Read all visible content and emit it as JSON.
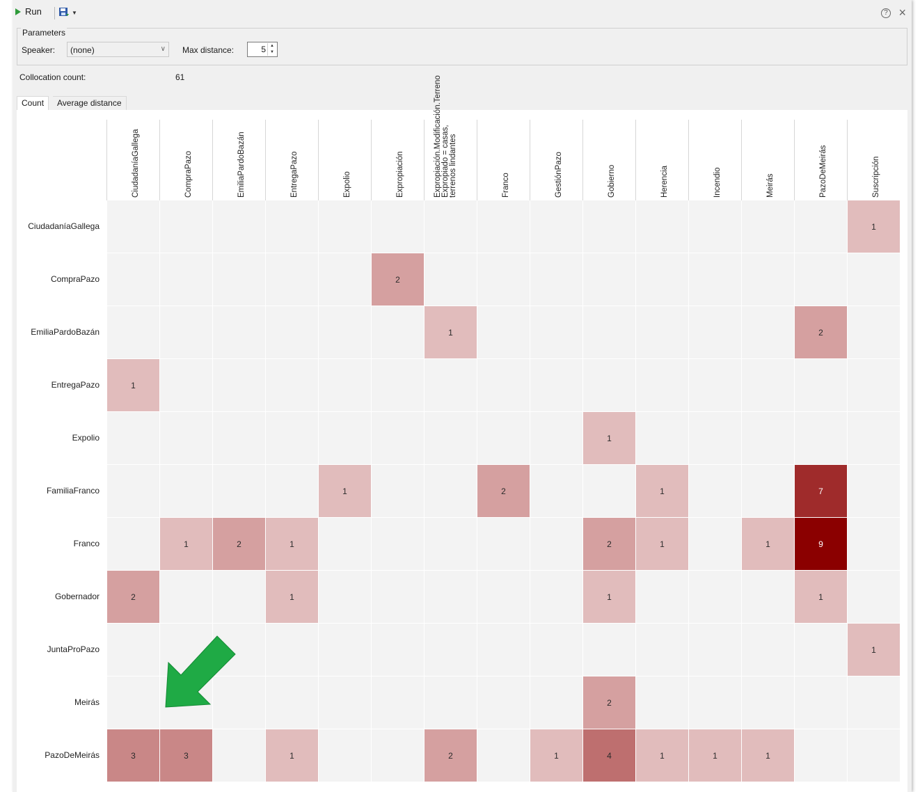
{
  "toolbar": {
    "run_label": "Run"
  },
  "parameters": {
    "title": "Parameters",
    "speaker_label": "Speaker:",
    "speaker_value": "(none)",
    "max_distance_label": "Max distance:",
    "max_distance_value": "5"
  },
  "collocation": {
    "label": "Collocation count:",
    "value": "61"
  },
  "tabs": [
    {
      "label": "Count"
    },
    {
      "label": "Average distance"
    }
  ],
  "matrix": {
    "columns": [
      "CiudadaníaGallega",
      "CompraPazo",
      "EmiliaPardoBazán",
      "EntregaPazo",
      "Expolio",
      "Expropiación",
      "Expropiación.Modificación.Terreno Expropiado = casas, terrenos lindantes",
      "Franco",
      "GestiónPazo",
      "Gobierno",
      "Herencia",
      "Incendio",
      "Meirás",
      "PazoDeMeirás",
      "Suscripción"
    ],
    "rows": [
      {
        "label": "CiudadaníaGallega",
        "cells": [
          null,
          null,
          null,
          null,
          null,
          null,
          null,
          null,
          null,
          null,
          null,
          null,
          null,
          null,
          1
        ]
      },
      {
        "label": "CompraPazo",
        "cells": [
          null,
          null,
          null,
          null,
          null,
          2,
          null,
          null,
          null,
          null,
          null,
          null,
          null,
          null,
          null
        ]
      },
      {
        "label": "EmiliaPardoBazán",
        "cells": [
          null,
          null,
          null,
          null,
          null,
          null,
          1,
          null,
          null,
          null,
          null,
          null,
          null,
          2,
          null
        ]
      },
      {
        "label": "EntregaPazo",
        "cells": [
          1,
          null,
          null,
          null,
          null,
          null,
          null,
          null,
          null,
          null,
          null,
          null,
          null,
          null,
          null
        ]
      },
      {
        "label": "Expolio",
        "cells": [
          null,
          null,
          null,
          null,
          null,
          null,
          null,
          null,
          null,
          1,
          null,
          null,
          null,
          null,
          null
        ]
      },
      {
        "label": "FamiliaFranco",
        "cells": [
          null,
          null,
          null,
          null,
          1,
          null,
          null,
          2,
          null,
          null,
          1,
          null,
          null,
          7,
          null
        ]
      },
      {
        "label": "Franco",
        "cells": [
          null,
          1,
          2,
          1,
          null,
          null,
          null,
          null,
          null,
          2,
          1,
          null,
          1,
          9,
          null
        ]
      },
      {
        "label": "Gobernador",
        "cells": [
          2,
          null,
          null,
          1,
          null,
          null,
          null,
          null,
          null,
          1,
          null,
          null,
          null,
          1,
          null
        ]
      },
      {
        "label": "JuntaProPazo",
        "cells": [
          null,
          null,
          null,
          null,
          null,
          null,
          null,
          null,
          null,
          null,
          null,
          null,
          null,
          null,
          1
        ]
      },
      {
        "label": "Meirás",
        "cells": [
          null,
          null,
          null,
          null,
          null,
          null,
          null,
          null,
          null,
          2,
          null,
          null,
          null,
          null,
          null
        ]
      },
      {
        "label": "PazoDeMeirás",
        "cells": [
          3,
          3,
          null,
          1,
          null,
          null,
          2,
          null,
          1,
          4,
          1,
          1,
          1,
          null,
          null
        ]
      }
    ]
  }
}
